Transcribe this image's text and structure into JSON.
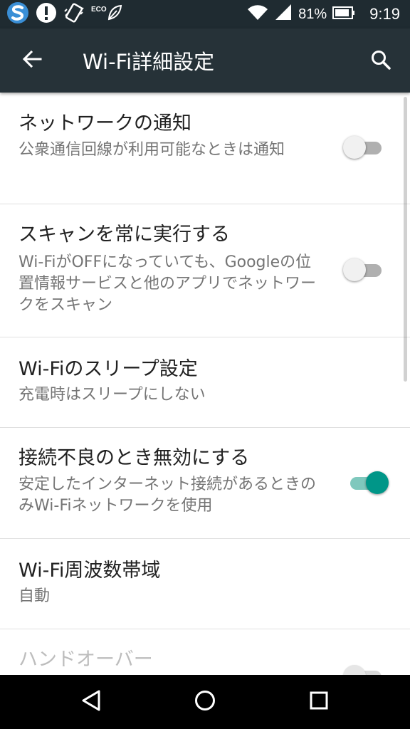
{
  "status_bar": {
    "eco_label": "ECO",
    "battery_percent": "81%",
    "time": "9:19",
    "icons": [
      "s-app-icon",
      "alert-icon",
      "vibrate-icon",
      "eco-leaf-icon",
      "wifi-icon",
      "cell-signal-icon",
      "battery-icon"
    ]
  },
  "app_bar": {
    "title": "Wi-Fi詳細設定",
    "back_icon": "arrow-back-icon",
    "search_icon": "search-icon",
    "background": "#263238"
  },
  "settings": [
    {
      "title": "ネットワークの通知",
      "subtitle": "公衆通信回線が利用可能なときは通知",
      "toggle": "off"
    },
    {
      "title": "スキャンを常に実行する",
      "subtitle": "Wi-FiがOFFになっていても、Googleの位置情報サービスと他のアプリでネットワークをスキャン",
      "toggle": "off"
    },
    {
      "title": "Wi-Fiのスリープ設定",
      "subtitle": "充電時はスリープにしない"
    },
    {
      "title": "接続不良のとき無効にする",
      "subtitle": "安定したインターネット接続があるときのみWi-Fiネットワークを使用",
      "toggle": "on"
    },
    {
      "title": "Wi-Fi周波数帯域",
      "subtitle": "自動"
    },
    {
      "title": "ハンドオーバー",
      "toggle": "off",
      "disabled": true
    }
  ],
  "nav_bar": {
    "icons": [
      "back-triangle-icon",
      "home-circle-icon",
      "recents-square-icon"
    ]
  },
  "colors": {
    "accent": "#009688",
    "accent_track": "#7fc8bd",
    "status_bar": "#1f2b31"
  }
}
